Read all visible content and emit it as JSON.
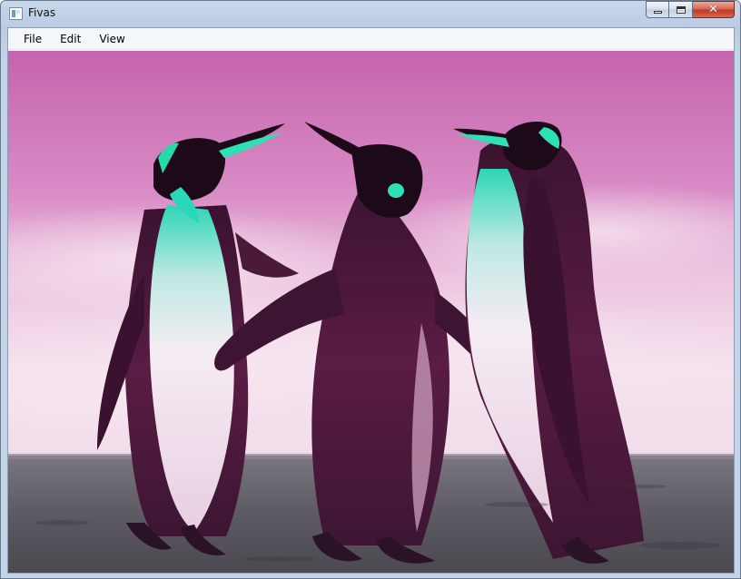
{
  "window": {
    "title": "Fivas",
    "buttons": {
      "minimize": "minimize",
      "maximize": "maximize",
      "close": "close"
    }
  },
  "menu": {
    "items": [
      {
        "label": "File"
      },
      {
        "label": "Edit"
      },
      {
        "label": "View"
      }
    ]
  },
  "image": {
    "subject": "three penguins on a beach with pink sky (false-color)",
    "palette": {
      "sky_top": "#c96ab0",
      "sky_bottom": "#f3dfeb",
      "ground": "#5a5a62",
      "penguin_body": "#4a1a38",
      "penguin_belly": "#f4e9f1",
      "accent": "#1fe0b4"
    }
  }
}
